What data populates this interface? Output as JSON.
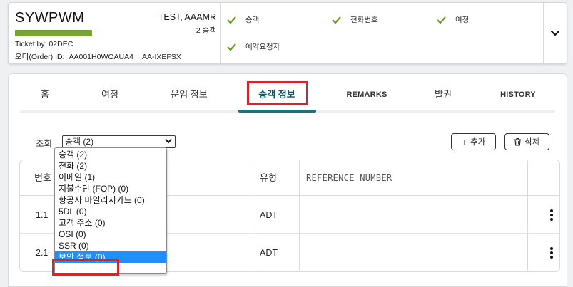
{
  "booking": {
    "pnr": "SYWPWM",
    "ticket_by": "Ticket by: 02DEC",
    "order_label": "오더(Order) ID:",
    "order_id": "AA001H0WOAUA4",
    "order_ref": "AA-IXEFSX",
    "passenger_name": "TEST, AAAMR",
    "passenger_count": "2 승객",
    "status_color": "#7aa335",
    "checks": [
      "승객",
      "전화번호",
      "여정",
      "예약요청자"
    ]
  },
  "tabs": [
    {
      "label": "홈"
    },
    {
      "label": "여정"
    },
    {
      "label": "운임 정보"
    },
    {
      "label": "승객 정보",
      "active": true
    },
    {
      "label": "REMARKS"
    },
    {
      "label": "발권"
    },
    {
      "label": "HISTORY"
    }
  ],
  "lookup": {
    "label": "조회",
    "selected": "승객 (2)",
    "options": [
      "승객 (2)",
      "전화 (2)",
      "이메일 (1)",
      "지불수단 (FOP) (0)",
      "항공사 마일리지카드 (0)",
      "5DL (0)",
      "고객 주소 (0)",
      "OSI (0)",
      "SSR (0)",
      "보안 정보 (0)"
    ],
    "highlighted_option": "보안 정보 (0)"
  },
  "actions": {
    "add": "추가",
    "delete": "삭제"
  },
  "table": {
    "headers": {
      "number": "번호",
      "type": "유형",
      "reference": "REFERENCE NUMBER"
    },
    "rows": [
      {
        "number": "1.1",
        "type": "ADT"
      },
      {
        "number": "2.1",
        "type": "ADT"
      }
    ]
  },
  "colors": {
    "accent": "#1f6f7d",
    "highlight": "#d8232a",
    "check": "#6a9a2c",
    "selected": "#1e90ff"
  }
}
